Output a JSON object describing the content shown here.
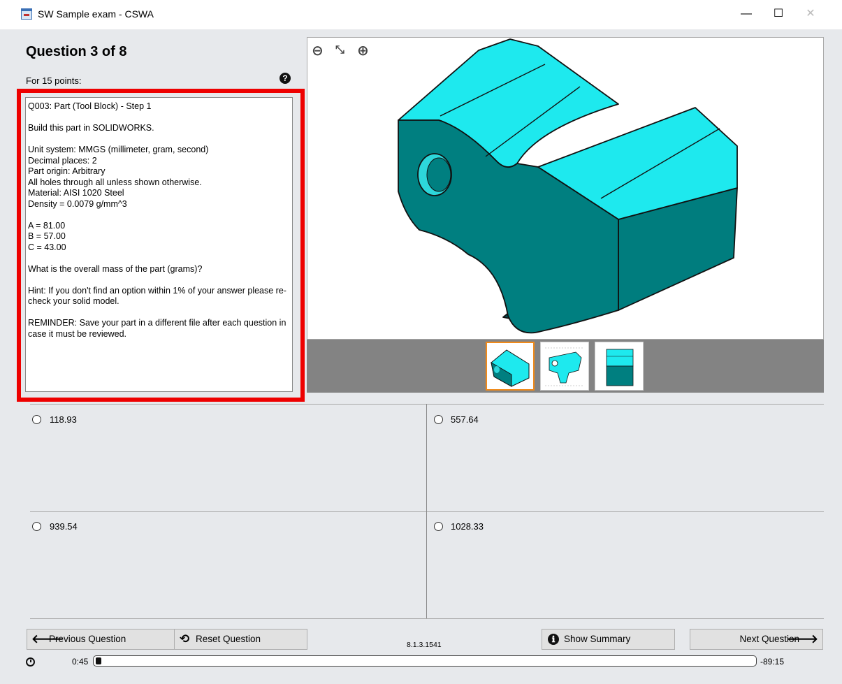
{
  "window": {
    "title": "SW Sample exam - CSWA",
    "minimize": "—",
    "maximize": "☐",
    "close": "✕"
  },
  "question": {
    "heading": "Question 3 of 8",
    "points": "For 15 points:",
    "help_glyph": "?",
    "body": "Q003: Part (Tool Block) - Step 1\n\nBuild this part in SOLIDWORKS.\n\nUnit system: MMGS (millimeter, gram, second)\nDecimal places: 2\nPart origin: Arbitrary\nAll holes through all unless shown otherwise.\nMaterial: AISI 1020 Steel\nDensity = 0.0079 g/mm^3\n\nA = 81.00\nB = 57.00\nC = 43.00\n\nWhat is the overall mass of the part (grams)?\n\nHint: If you don't find an option within 1% of your answer please re-check your solid model.\n\nREMINDER: Save your part in a different file after each question in case it must be reviewed."
  },
  "viewer": {
    "zoom_out_glyph": "⊖",
    "fit_glyph": "⤡",
    "zoom_in_glyph": "⊕",
    "colors": {
      "cyan_face": "#1ee9ee",
      "dark_face": "#007f7f",
      "mid_face": "#00aaaa"
    }
  },
  "options": [
    "118.93",
    "557.64",
    "939.54",
    "1028.33"
  ],
  "nav": {
    "previous_label": "Previous Question",
    "previous_glyph": "🡐",
    "reset_label": "Reset Question",
    "reset_glyph": "⟲",
    "summary_label": "Show Summary",
    "summary_glyph": "ℹ",
    "next_label": "Next Question",
    "next_glyph": "🡒"
  },
  "version": "8.1.3.1541",
  "timer": {
    "elapsed": "0:45",
    "remaining": "-89:15",
    "progress_fraction": 0.008
  }
}
